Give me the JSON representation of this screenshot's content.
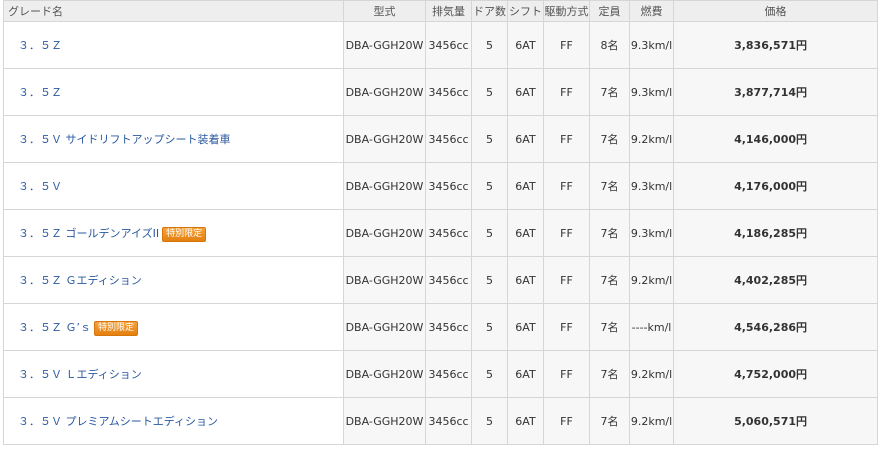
{
  "headers": {
    "grade": "グレード名",
    "model": "型式",
    "displacement": "排気量",
    "doors": "ドア数",
    "shift": "シフト",
    "drive": "駆動方式",
    "capacity": "定員",
    "fuel": "燃費",
    "price": "価格"
  },
  "rows": [
    {
      "grade": "３．５Ｚ",
      "badge": "",
      "model": "DBA-GGH20W",
      "displacement": "3456cc",
      "doors": "5",
      "shift": "6AT",
      "drive": "FF",
      "capacity": "8名",
      "fuel": "9.3km/l",
      "price": "3,836,571円"
    },
    {
      "grade": "３．５Ｚ",
      "badge": "",
      "model": "DBA-GGH20W",
      "displacement": "3456cc",
      "doors": "5",
      "shift": "6AT",
      "drive": "FF",
      "capacity": "7名",
      "fuel": "9.3km/l",
      "price": "3,877,714円"
    },
    {
      "grade": "３．５Ｖ サイドリフトアップシート装着車",
      "badge": "",
      "model": "DBA-GGH20W",
      "displacement": "3456cc",
      "doors": "5",
      "shift": "6AT",
      "drive": "FF",
      "capacity": "7名",
      "fuel": "9.2km/l",
      "price": "4,146,000円"
    },
    {
      "grade": "３．５Ｖ",
      "badge": "",
      "model": "DBA-GGH20W",
      "displacement": "3456cc",
      "doors": "5",
      "shift": "6AT",
      "drive": "FF",
      "capacity": "7名",
      "fuel": "9.3km/l",
      "price": "4,176,000円"
    },
    {
      "grade": "３．５Ｚ ゴールデンアイズII",
      "badge": "特別限定",
      "model": "DBA-GGH20W",
      "displacement": "3456cc",
      "doors": "5",
      "shift": "6AT",
      "drive": "FF",
      "capacity": "7名",
      "fuel": "9.3km/l",
      "price": "4,186,285円"
    },
    {
      "grade": "３．５Ｚ Ｇエディション",
      "badge": "",
      "model": "DBA-GGH20W",
      "displacement": "3456cc",
      "doors": "5",
      "shift": "6AT",
      "drive": "FF",
      "capacity": "7名",
      "fuel": "9.2km/l",
      "price": "4,402,285円"
    },
    {
      "grade": "３．５Ｚ Ｇ’ｓ",
      "badge": "特別限定",
      "model": "DBA-GGH20W",
      "displacement": "3456cc",
      "doors": "5",
      "shift": "6AT",
      "drive": "FF",
      "capacity": "7名",
      "fuel": "----km/l",
      "price": "4,546,286円"
    },
    {
      "grade": "３．５Ｖ Ｌエディション",
      "badge": "",
      "model": "DBA-GGH20W",
      "displacement": "3456cc",
      "doors": "5",
      "shift": "6AT",
      "drive": "FF",
      "capacity": "7名",
      "fuel": "9.2km/l",
      "price": "4,752,000円"
    },
    {
      "grade": "３．５Ｖ プレミアムシートエディション",
      "badge": "",
      "model": "DBA-GGH20W",
      "displacement": "3456cc",
      "doors": "5",
      "shift": "6AT",
      "drive": "FF",
      "capacity": "7名",
      "fuel": "9.2km/l",
      "price": "5,060,571円"
    }
  ],
  "colors": {
    "link": "#2a59a0",
    "badge": "#e4800f",
    "header_bg": "#eeeeee",
    "border": "#d6d6d6"
  }
}
